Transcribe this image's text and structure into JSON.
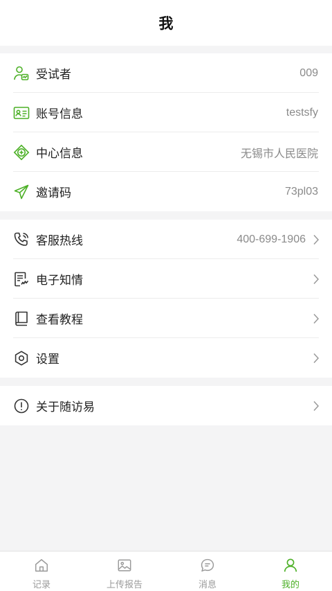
{
  "header": {
    "title": "我"
  },
  "group1": [
    {
      "label": "受试者",
      "value": "009",
      "icon": "subject-icon"
    },
    {
      "label": "账号信息",
      "value": "testsfy",
      "icon": "id-card-icon"
    },
    {
      "label": "中心信息",
      "value": "无锡市人民医院",
      "icon": "medical-center-icon"
    },
    {
      "label": "邀请码",
      "value": "73pl03",
      "icon": "paper-plane-icon"
    }
  ],
  "group2": [
    {
      "label": "客服热线",
      "value": "400-699-1906",
      "icon": "phone-icon"
    },
    {
      "label": "电子知情",
      "value": "",
      "icon": "signature-doc-icon"
    },
    {
      "label": "查看教程",
      "value": "",
      "icon": "book-icon"
    },
    {
      "label": "设置",
      "value": "",
      "icon": "settings-icon"
    }
  ],
  "group3": [
    {
      "label": "关于随访易",
      "value": "",
      "icon": "info-icon"
    }
  ],
  "tabbar": [
    {
      "label": "记录",
      "icon": "home-icon"
    },
    {
      "label": "上传报告",
      "icon": "image-upload-icon"
    },
    {
      "label": "消息",
      "icon": "message-icon"
    },
    {
      "label": "我的",
      "icon": "profile-icon",
      "active": true
    }
  ],
  "colors": {
    "accent": "#4cb026",
    "icon_gray": "#333333",
    "value_gray": "#8a8a8a"
  }
}
